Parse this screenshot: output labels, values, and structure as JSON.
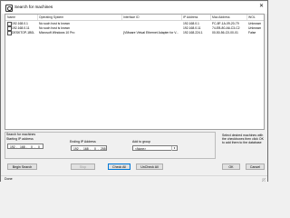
{
  "window": {
    "title": "Search for machines"
  },
  "columns": [
    "Name",
    "Operating System",
    "Interface ID",
    "IP Address",
    "Mac Address",
    "WOL"
  ],
  "rows": [
    {
      "name": "192.168.0.1",
      "os": "No such host is known",
      "iface": "",
      "ip": "192.168.0.1",
      "mac": "FC-8F-1A-09-20-79",
      "wol": "Unknown"
    },
    {
      "name": "192.168.0.11",
      "os": "No such host is known",
      "iface": "",
      "ip": "192.168.0.11",
      "mac": "74-EB-80-A6-C3-C2",
      "wol": "Unknown"
    },
    {
      "name": "DESKTOP-1B0L",
      "os": "Microsoft Windows 10 Pro",
      "iface": "{VMware Virtual Ethernet Adapter for V...",
      "ip": "192.168.224.1",
      "mac": "00-50-56-C0-00-01",
      "wol": "False"
    }
  ],
  "search": {
    "title": "Search for machines",
    "start_label": "Starting IP address",
    "start_ip": [
      "192",
      "168",
      "0",
      "0"
    ],
    "end_label": "Ending IP Address",
    "end_ip": [
      "192",
      "168",
      "0",
      "255"
    ],
    "group_label": "Add to group",
    "group_value": "<None>"
  },
  "hint": "Select desired machines with the checkboxes then click OK to add them to the database",
  "buttons": {
    "begin": "Begin Search",
    "stop": "Stop",
    "check_all": "Check All",
    "uncheck_all": "UnCheck All",
    "ok": "OK",
    "cancel": "Cancel"
  },
  "status": "Done"
}
